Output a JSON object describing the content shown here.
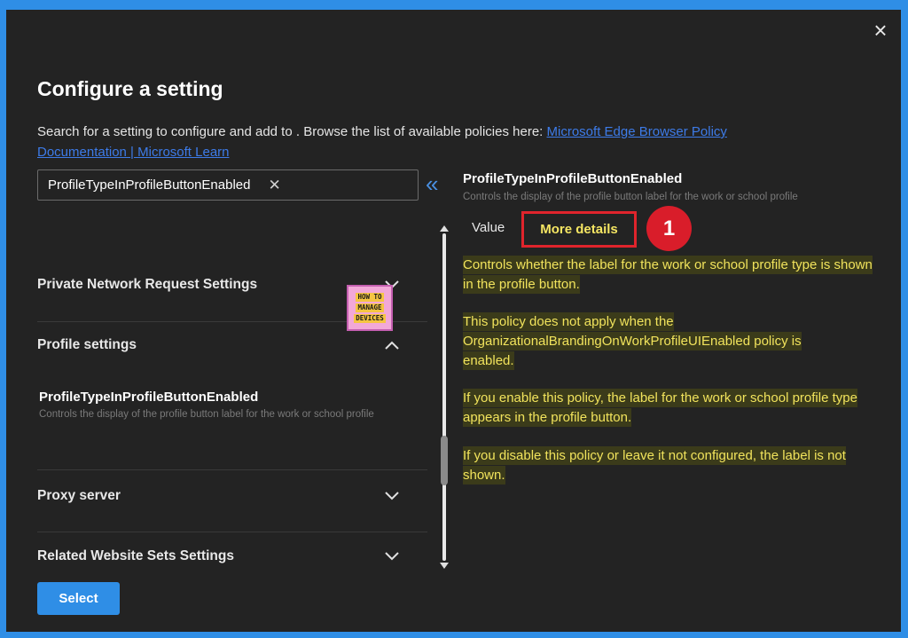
{
  "dialog": {
    "title": "Configure a setting",
    "description": "Search for a setting to configure and add to . Browse the list of available policies here:",
    "doc_link": "Microsoft Edge Browser Policy Documentation | Microsoft Learn",
    "close_icon": "close-icon"
  },
  "search": {
    "value": "ProfileTypeInProfileButtonEnabled",
    "clear_icon": "clear-icon",
    "clear_glyph": "✕"
  },
  "collapse_glyph": "«",
  "sections": [
    {
      "label": "Private Network Request Settings",
      "expanded": false
    },
    {
      "label": "Profile settings",
      "expanded": true
    },
    {
      "label": "Proxy server",
      "expanded": false
    },
    {
      "label": "Related Website Sets Settings",
      "expanded": false
    }
  ],
  "setting_item": {
    "name": "ProfileTypeInProfileButtonEnabled",
    "description": "Controls the display of the profile button label for the work or school profile"
  },
  "logo": {
    "line1": "HOW TO",
    "line2": "MANAGE",
    "line3": "DEVICES"
  },
  "details": {
    "title": "ProfileTypeInProfileButtonEnabled",
    "subtitle": "Controls the display of the profile button label for the work or school profile",
    "tabs": {
      "value": "Value",
      "more_details": "More details"
    },
    "step_number": "1",
    "paragraphs": [
      "Controls whether the label for the work or school profile type is shown in the profile button.",
      "This policy does not apply when the OrganizationalBrandingOnWorkProfileUIEnabled policy is enabled.",
      "If you enable this policy, the label for the work or school profile type appears in the profile button.",
      "If you disable this policy or leave it not configured, the label is not shown."
    ]
  },
  "footer": {
    "select_label": "Select"
  },
  "colors": {
    "accent": "#2f8ee6",
    "highlight_text": "#f1e35c",
    "annotation_red": "#e0242c",
    "background": "#232323"
  }
}
